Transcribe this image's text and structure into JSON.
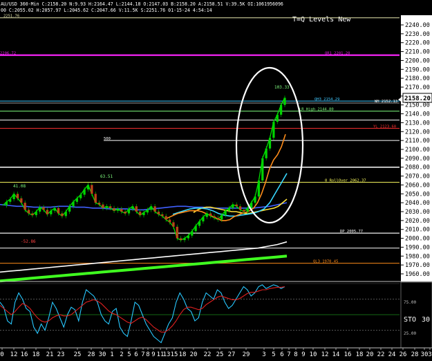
{
  "header": {
    "row1": "AU/USD  360-Min  C:2158.20  N:9.93  H:2164.47  L:2144.18  O:2147.03  B:2158.20  A:2158.51  V:39.5K  OI:1061956096",
    "row2": "00  C:2055.02  H:2057.97  L:2045.62  C:2047.66  V:11.5K  S:2251.76  01-15-24  4:54:14"
  },
  "chart_title": "T=Q Levels New",
  "chart_data": {
    "type": "line",
    "price_axis": {
      "ylim": [
        1950,
        2250
      ],
      "ticks": [
        "2240.00",
        "2230.00",
        "2220.00",
        "2210.00",
        "2200.00",
        "2190.00",
        "2180.00",
        "2170.00",
        "2160.00",
        "2150.00",
        "2140.00",
        "2130.00",
        "2120.00",
        "2110.00",
        "2100.00",
        "2090.00",
        "2080.00",
        "2070.00",
        "2060.00",
        "2050.00",
        "2040.00",
        "2030.00",
        "2020.00",
        "2010.00",
        "2000.00",
        "1990.00",
        "1980.00",
        "1970.00",
        "1960.00"
      ],
      "last_price": "2158.20"
    },
    "x_ticks": [
      "0",
      "12",
      "16",
      "18",
      "21",
      "23",
      "25",
      "28",
      "30",
      "1",
      "2",
      "5",
      "6",
      "7",
      "8",
      "9",
      "11",
      "13",
      "15",
      "18",
      "20",
      "22",
      "25",
      "27",
      "29",
      "3",
      "5",
      "6",
      "7",
      "8",
      "9",
      "10",
      "12",
      "14",
      "16",
      "18",
      "20",
      "22",
      "24",
      "26",
      "28",
      "30",
      "3"
    ],
    "levels": [
      {
        "label": "2251.76",
        "value": 2248,
        "color": "#e8e8b0",
        "side": "left"
      },
      {
        "label": "QR1 2201.20",
        "value": 2206,
        "color": "#e020e0",
        "side": "right"
      },
      {
        "label": "2206.72",
        "value": 2206,
        "color": "#e020e0",
        "side": "far-left"
      },
      {
        "label": "QH3 2154.29",
        "value": 2154.3,
        "color": "#40c8ff",
        "side": "mid"
      },
      {
        "label": "WH 2152.13",
        "value": 2152.1,
        "color": "#a0a0a0",
        "side": "right"
      },
      {
        "label": "LR High 2144.80",
        "value": 2143,
        "color": "#80ff80",
        "side": "mid"
      },
      {
        "label": "YL 2123.60",
        "value": 2123.6,
        "color": "#ff3030",
        "side": "right"
      },
      {
        "label": "500",
        "value": 2110,
        "color": "#ffffff",
        "side": "left-mid"
      },
      {
        "label": "0 RollOver 2062.37",
        "value": 2063,
        "color": "#ffff60",
        "side": "mid"
      },
      {
        "label": "DP 2005.77",
        "value": 2005.8,
        "color": "#ffffff",
        "side": "mid"
      },
      {
        "label": "QL3 1970.45",
        "value": 1972,
        "color": "#ff8c1a",
        "side": "mid"
      }
    ],
    "annotations": [
      "41.08",
      "63.51",
      "-52.86",
      "103.33"
    ],
    "price_series": [
      {
        "name": "close",
        "color": "#00e000",
        "values": [
          2037,
          2041,
          2044,
          2050,
          2045,
          2040,
          2032,
          2028,
          2026,
          2030,
          2035,
          2032,
          2027,
          2031,
          2034,
          2028,
          2025,
          2030,
          2036,
          2041,
          2045,
          2049,
          2055,
          2060,
          2050,
          2040,
          2038,
          2034,
          2036,
          2034,
          2031,
          2033,
          2030,
          2028,
          2033,
          2036,
          2030,
          2026,
          2029,
          2032,
          2036,
          2030,
          2027,
          2025,
          2021,
          2018,
          2013,
          2000,
          1998,
          2000,
          2003,
          2008,
          2014,
          2019,
          2024,
          2028,
          2025,
          2023,
          2021,
          2026,
          2031,
          2034,
          2038,
          2036,
          2032,
          2030,
          2034,
          2040,
          2047,
          2065,
          2090,
          2101,
          2113,
          2131,
          2139,
          2150,
          2158
        ]
      },
      {
        "name": "ma-blue",
        "color": "#4060ff",
        "values": [
          2038,
          2037,
          2036,
          2036,
          2035,
          2035,
          2035,
          2036,
          2036,
          2035,
          2035,
          2034,
          2034,
          2033,
          2033,
          2033,
          2032,
          2032,
          2033,
          2034,
          2035,
          2036,
          2036,
          2035,
          2035,
          2034,
          2034,
          2034,
          2034,
          2034,
          2034,
          2035,
          2036,
          2038,
          2040
        ]
      },
      {
        "name": "ma-orange",
        "color": "#ff8c1a",
        "values": [
          2022,
          2024,
          2026,
          2028,
          2029,
          2030,
          2031,
          2031,
          2031,
          2030,
          2028,
          2026,
          2024,
          2022,
          2020,
          2020,
          2021,
          2024,
          2026,
          2028,
          2029,
          2031,
          2034,
          2040,
          2050,
          2063,
          2078,
          2088,
          2094,
          2103,
          2117
        ]
      },
      {
        "name": "ma-yellow",
        "color": "#ffe23a",
        "values": [
          2029,
          2032,
          2034,
          2035,
          2035,
          2034,
          2033,
          2032,
          2031,
          2030,
          2030,
          2029,
          2028,
          2028,
          2029,
          2030,
          2031,
          2032,
          2033,
          2034,
          2036,
          2040,
          2044
        ]
      },
      {
        "name": "ma-cyan",
        "color": "#38d8ff",
        "values": [
          2027,
          2029,
          2031,
          2033,
          2034,
          2034,
          2033,
          2031,
          2028,
          2026,
          2025,
          2025,
          2026,
          2027,
          2028,
          2030,
          2033,
          2040,
          2051,
          2062,
          2073
        ]
      },
      {
        "name": "ma-white",
        "color": "#ffffff",
        "values": [
          1962,
          1963,
          1964,
          1965,
          1966,
          1967,
          1968,
          1969,
          1970,
          1971,
          1972,
          1973,
          1974,
          1975,
          1976,
          1977,
          1978,
          1979,
          1980,
          1981,
          1982,
          1983,
          1984,
          1985,
          1986,
          1987,
          1988,
          1989,
          1991,
          1993,
          1996
        ]
      },
      {
        "name": "ma-green",
        "color": "#40ff20",
        "values": [
          1952,
          1953,
          1954,
          1955,
          1956,
          1957,
          1958,
          1959,
          1960,
          1961,
          1962,
          1963,
          1964,
          1965,
          1966,
          1967,
          1968,
          1969,
          1970,
          1971,
          1972,
          1973,
          1974,
          1975,
          1976,
          1977,
          1978,
          1979,
          1980
        ]
      }
    ],
    "oscillator": {
      "label": "STO",
      "period": "30",
      "ylim": [
        0,
        100
      ],
      "ticks": [
        "75.00",
        "25.00"
      ],
      "series": [
        {
          "name": "k",
          "color": "#28c8ff",
          "values": [
            70,
            62,
            40,
            35,
            70,
            85,
            75,
            60,
            55,
            30,
            20,
            35,
            25,
            45,
            70,
            60,
            45,
            30,
            50,
            62,
            58,
            40,
            70,
            90,
            85,
            80,
            70,
            50,
            40,
            35,
            55,
            60,
            30,
            20,
            15,
            40,
            70,
            65,
            50,
            35,
            25,
            15,
            10,
            5,
            20,
            35,
            45,
            70,
            85,
            75,
            60,
            55,
            40,
            45,
            70,
            85,
            80,
            75,
            90,
            85,
            70,
            60,
            65,
            75,
            85,
            95,
            90,
            80,
            85,
            95,
            98,
            92,
            95,
            98,
            96,
            92,
            95
          ]
        },
        {
          "name": "d",
          "color": "#e02020",
          "values": [
            65,
            60,
            55,
            50,
            55,
            62,
            68,
            65,
            60,
            52,
            45,
            40,
            38,
            40,
            45,
            48,
            50,
            48,
            48,
            50,
            55,
            60,
            65,
            70,
            72,
            74,
            72,
            68,
            62,
            56,
            52,
            50,
            46,
            42,
            38,
            36,
            40,
            44,
            46,
            42,
            36,
            30,
            26,
            22,
            22,
            26,
            32,
            40,
            50,
            58,
            62,
            62,
            60,
            58,
            60,
            66,
            70,
            74,
            78,
            80,
            78,
            76,
            74,
            74,
            76,
            80,
            84,
            86,
            86,
            88,
            90,
            90,
            92,
            93,
            94,
            94,
            95
          ]
        }
      ]
    }
  },
  "colors": {
    "background": "#000000",
    "axis_panel": "#ffffff",
    "ellipse": "#ffffff"
  }
}
